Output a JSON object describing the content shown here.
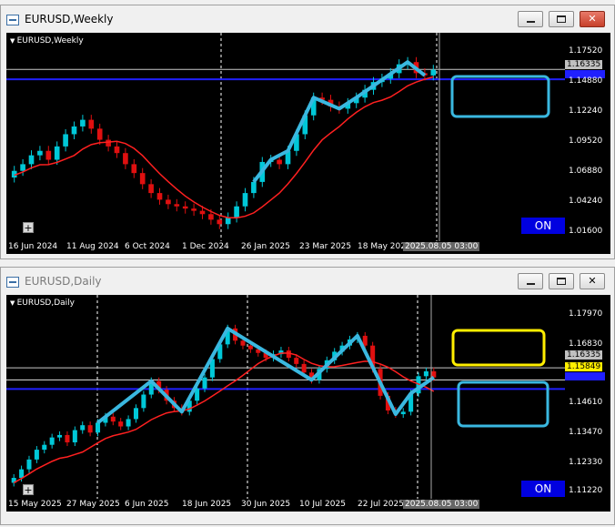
{
  "colors": {
    "bull": "#00c8d8",
    "bear": "#e01010",
    "ma": "#ff2020",
    "wave": "#3ab8e0",
    "hline_blue": "#2020ff",
    "yellow": "#ffee00",
    "on_button": "#0000e0"
  },
  "window_top": {
    "title": "EURUSD,Weekly",
    "chart_label": "EURUSD,Weekly",
    "current_price": "1.16335",
    "time_labels": [
      "16 Jun 2024",
      "11 Aug 2024",
      "6 Oct 2024",
      "1 Dec 2024",
      "26 Jan 2025",
      "23 Mar 2025",
      "18 May 2025"
    ],
    "crosshair_time": "2025.08.05 03:00",
    "price_labels": [
      "1.17520",
      "1.14880",
      "1.12240",
      "1.09520",
      "1.06880",
      "1.04240",
      "1.01600"
    ],
    "on_button": "ON",
    "plus_button": "+"
  },
  "window_bottom": {
    "title": "EURUSD,Daily",
    "chart_label": "EURUSD,Daily",
    "current_price": "1.16335",
    "level_price": "1.15849",
    "time_labels": [
      "15 May 2025",
      "27 May 2025",
      "6 Jun 2025",
      "18 Jun 2025",
      "30 Jun 2025",
      "10 Jul 2025",
      "22 Jul 2025"
    ],
    "crosshair_time": "2025.08.05 03:00",
    "price_labels": [
      "1.17970",
      "1.16830",
      "1.15750",
      "1.14610",
      "1.13470",
      "1.12330",
      "1.11220"
    ],
    "on_button": "ON",
    "plus_button": "+"
  },
  "chart_data": [
    {
      "type": "candlestick",
      "title": "EURUSD,Weekly",
      "ylim": [
        1.016,
        1.18
      ],
      "x": [
        "16 Jun 2024",
        "11 Aug 2024",
        "6 Oct 2024",
        "1 Dec 2024",
        "26 Jan 2025",
        "23 Mar 2025",
        "18 May 2025"
      ],
      "close_path": [
        1.072,
        1.078,
        1.086,
        1.09,
        1.082,
        1.094,
        1.105,
        1.112,
        1.118,
        1.11,
        1.1,
        1.094,
        1.088,
        1.078,
        1.07,
        1.06,
        1.052,
        1.046,
        1.042,
        1.04,
        1.038,
        1.036,
        1.033,
        1.028,
        1.024,
        1.03,
        1.04,
        1.052,
        1.062,
        1.08,
        1.082,
        1.078,
        1.09,
        1.105,
        1.122,
        1.138,
        1.136,
        1.13,
        1.128,
        1.133,
        1.138,
        1.145,
        1.152,
        1.155,
        1.16,
        1.168,
        1.17,
        1.16,
        1.158,
        1.163
      ]
    },
    {
      "type": "candlestick",
      "title": "EURUSD,Daily",
      "ylim": [
        1.1122,
        1.1865
      ],
      "x": [
        "15 May 2025",
        "27 May 2025",
        "6 Jun 2025",
        "18 Jun 2025",
        "30 Jun 2025",
        "10 Jul 2025",
        "22 Jul 2025"
      ],
      "close_path": [
        1.1185,
        1.122,
        1.126,
        1.13,
        1.132,
        1.135,
        1.136,
        1.133,
        1.138,
        1.14,
        1.137,
        1.141,
        1.1435,
        1.1415,
        1.1395,
        1.1425,
        1.147,
        1.1525,
        1.158,
        1.1545,
        1.15,
        1.147,
        1.1455,
        1.15,
        1.155,
        1.1595,
        1.167,
        1.173,
        1.1795,
        1.1745,
        1.1725,
        1.171,
        1.1695,
        1.1675,
        1.169,
        1.1705,
        1.1675,
        1.165,
        1.1615,
        1.1585,
        1.163,
        1.1665,
        1.17,
        1.1725,
        1.175,
        1.1765,
        1.1725,
        1.163,
        1.152,
        1.146,
        1.1445,
        1.1455,
        1.153,
        1.16,
        1.162,
        1.1595
      ]
    }
  ]
}
